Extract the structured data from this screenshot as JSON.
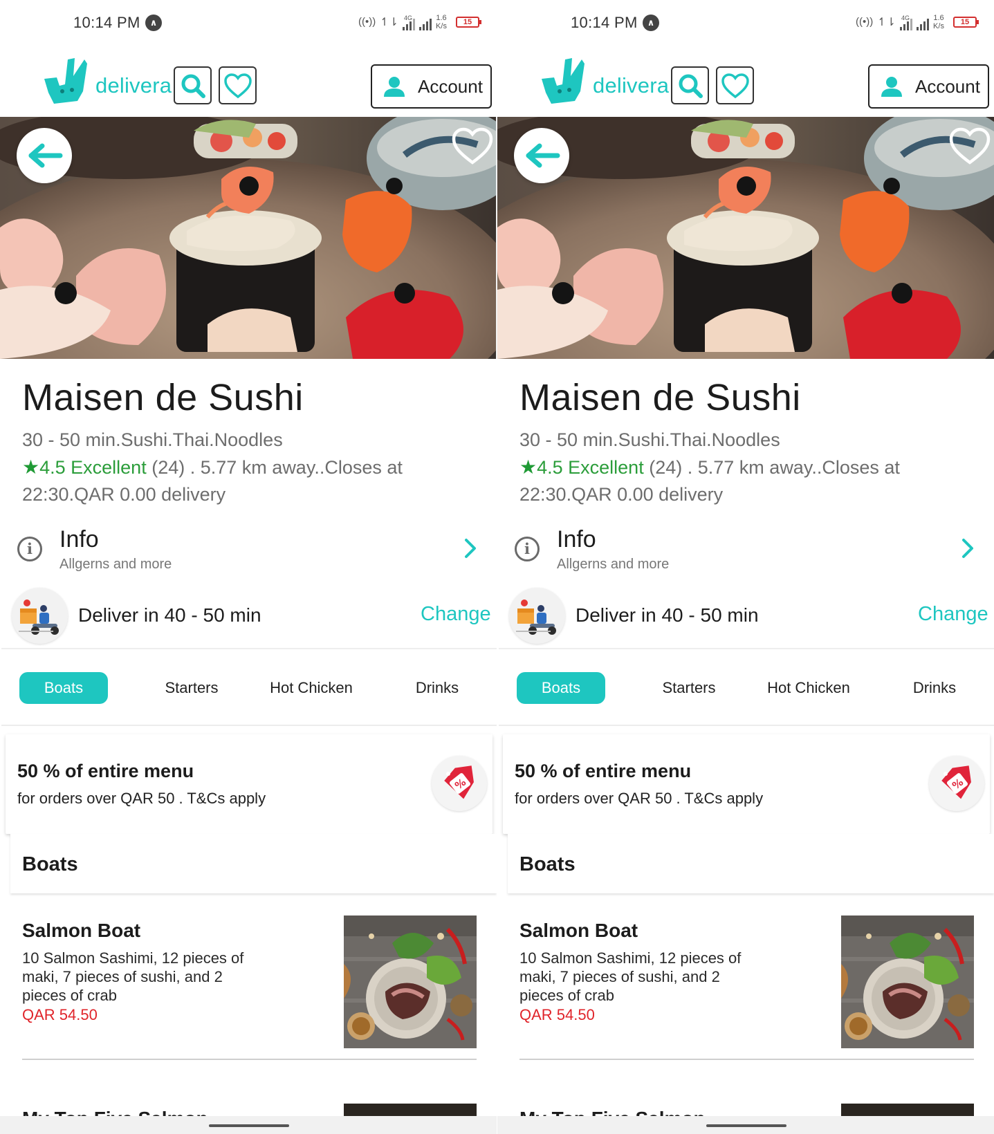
{
  "status_bar": {
    "time": "10:14 PM",
    "network_label": "4G",
    "speed_value": "1.6",
    "speed_unit": "K/s",
    "battery": "15"
  },
  "header": {
    "brand": "delivera",
    "account_label": "Account",
    "accent_color": "#1ec6c0"
  },
  "restaurant": {
    "name": "Maisen de Sushi",
    "meta_line": "30 - 50 min.Sushi.Thai.Noodles",
    "rating": "4.5 Excellent",
    "reviews": "(24)",
    "distance_closing": ". 5.77 km away..Closes at",
    "closing_delivery": "22:30.QAR 0.00 delivery"
  },
  "info": {
    "title": "Info",
    "subtitle": "Allgerns and more"
  },
  "delivery": {
    "text": "Deliver in 40 - 50 min",
    "change_label": "Change"
  },
  "tabs": [
    {
      "label": "Boats",
      "active": true
    },
    {
      "label": "Starters",
      "active": false
    },
    {
      "label": "Hot Chicken",
      "active": false
    },
    {
      "label": "Drinks",
      "active": false
    }
  ],
  "promo": {
    "title": "50 % of entire menu",
    "subtitle": "for orders over QAR 50 . T&Cs apply"
  },
  "section": {
    "title": "Boats"
  },
  "menu_items": [
    {
      "name": "Salmon Boat",
      "description": "10 Salmon Sashimi, 12 pieces of maki, 7 pieces of sushi, and 2 pieces of crab",
      "price": "QAR 54.50"
    },
    {
      "name": "My Top Five Salmon"
    }
  ]
}
